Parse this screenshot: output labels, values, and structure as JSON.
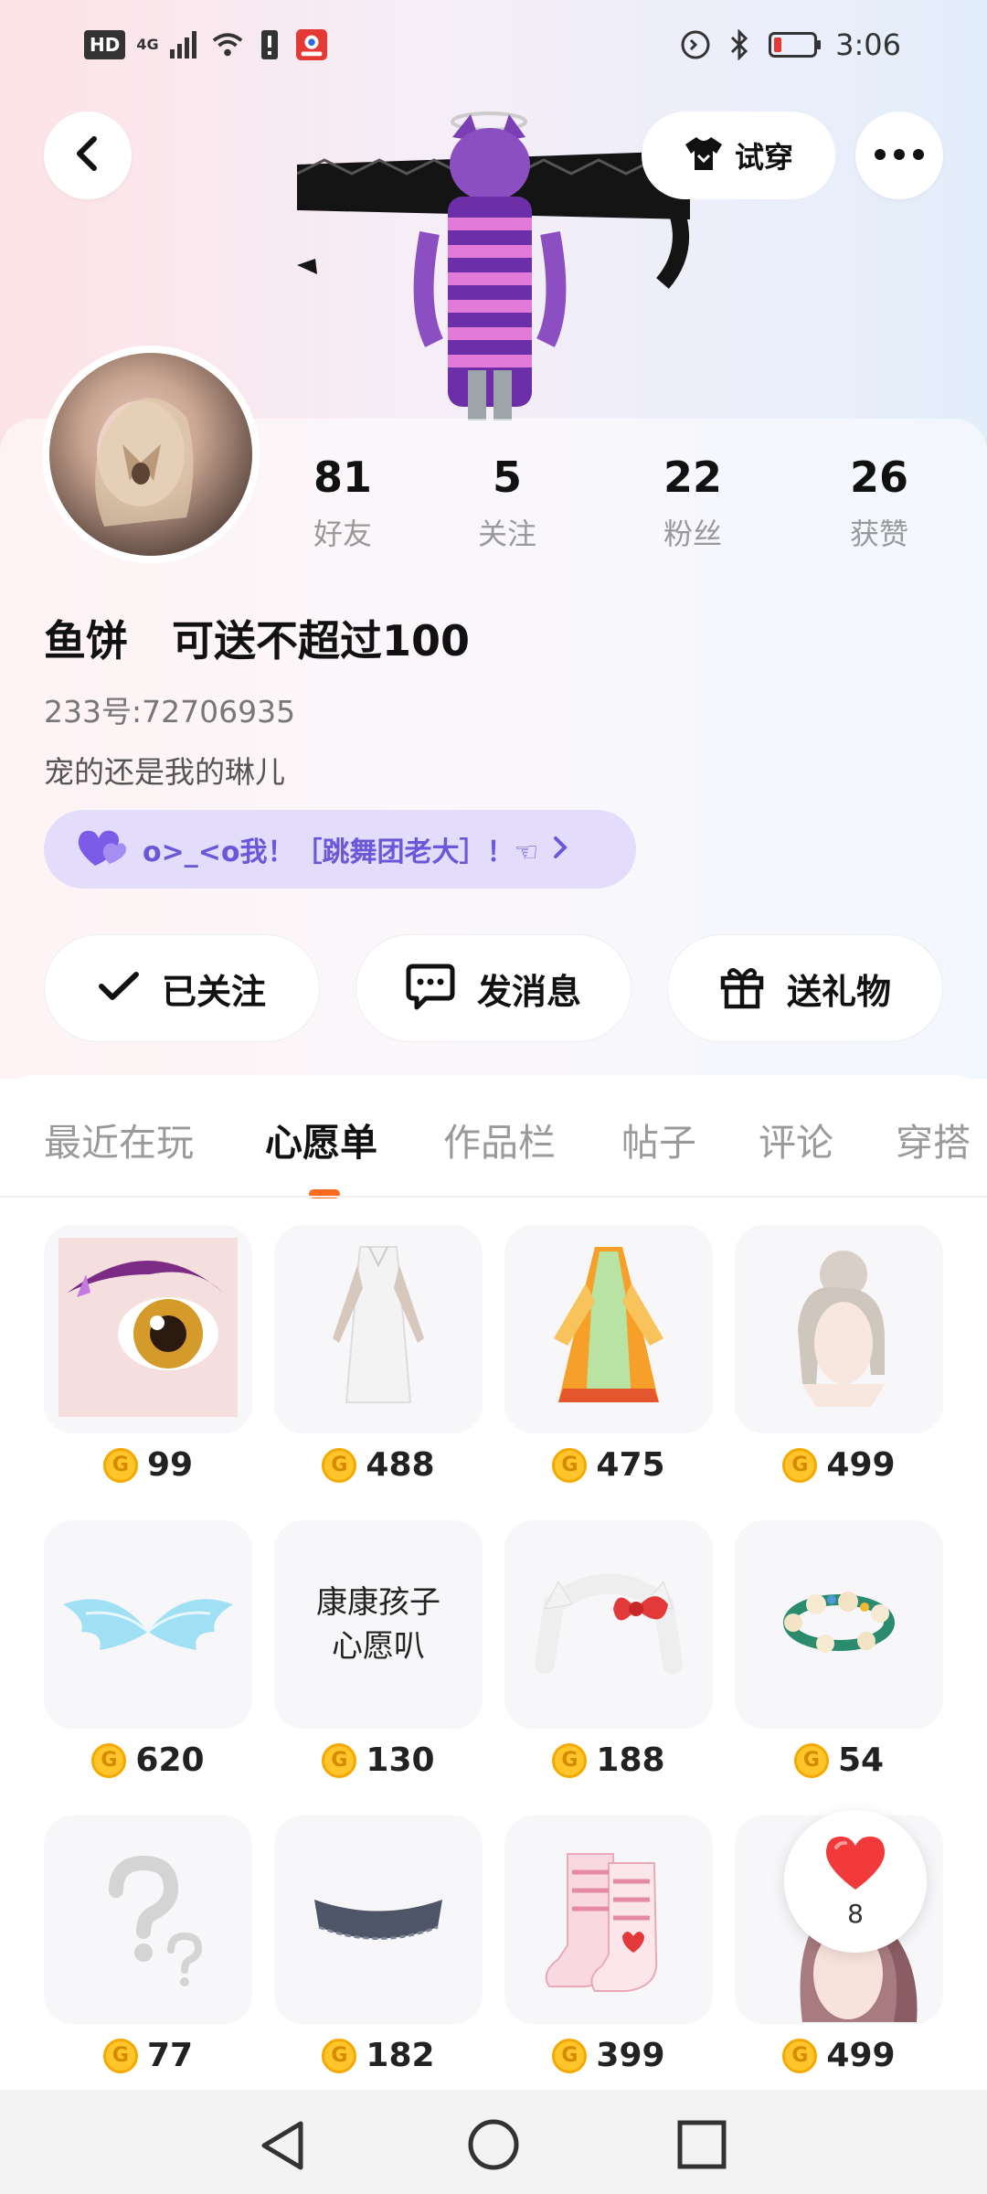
{
  "status_bar": {
    "hd": "HD",
    "network": "4G",
    "time": "3:06"
  },
  "header": {
    "tryon_label": "试穿"
  },
  "profile": {
    "stats": [
      {
        "value": "81",
        "label": "好友"
      },
      {
        "value": "5",
        "label": "关注"
      },
      {
        "value": "22",
        "label": "粉丝"
      },
      {
        "value": "26",
        "label": "获赞"
      }
    ],
    "username": "鱼饼   可送不超过100",
    "uid": "233号:72706935",
    "bio": "宠的还是我的琳儿",
    "group": "o>_<o我！［跳舞团老大］！☜"
  },
  "actions": {
    "follow": "已关注",
    "message": "发消息",
    "gift": "送礼物"
  },
  "tabs": [
    "最近在玩",
    "心愿单",
    "作品栏",
    "帖子",
    "评论",
    "穿搭"
  ],
  "active_tab": "心愿单",
  "wishlist": {
    "items": [
      {
        "price": "99",
        "icon": "eye-makeup"
      },
      {
        "price": "488",
        "icon": "white-dress"
      },
      {
        "price": "475",
        "icon": "hanfu-dress"
      },
      {
        "price": "499",
        "icon": "bun-hairstyle"
      },
      {
        "price": "620",
        "icon": "angel-wings"
      },
      {
        "price": "130",
        "icon": "wish-text-card",
        "card_text_1": "康康孩子",
        "card_text_2": "心愿叭"
      },
      {
        "price": "188",
        "icon": "bow-headband"
      },
      {
        "price": "54",
        "icon": "flower-crown"
      },
      {
        "price": "77",
        "icon": "question-mark"
      },
      {
        "price": "182",
        "icon": "lace-choker"
      },
      {
        "price": "399",
        "icon": "boots"
      },
      {
        "price": "499",
        "icon": "ponytail-hairstyle"
      }
    ]
  },
  "like_fab": {
    "count": "8"
  },
  "colors": {
    "accent": "#ff6a1f",
    "group_text": "#6b57d9",
    "coin": "#ffc52a"
  }
}
